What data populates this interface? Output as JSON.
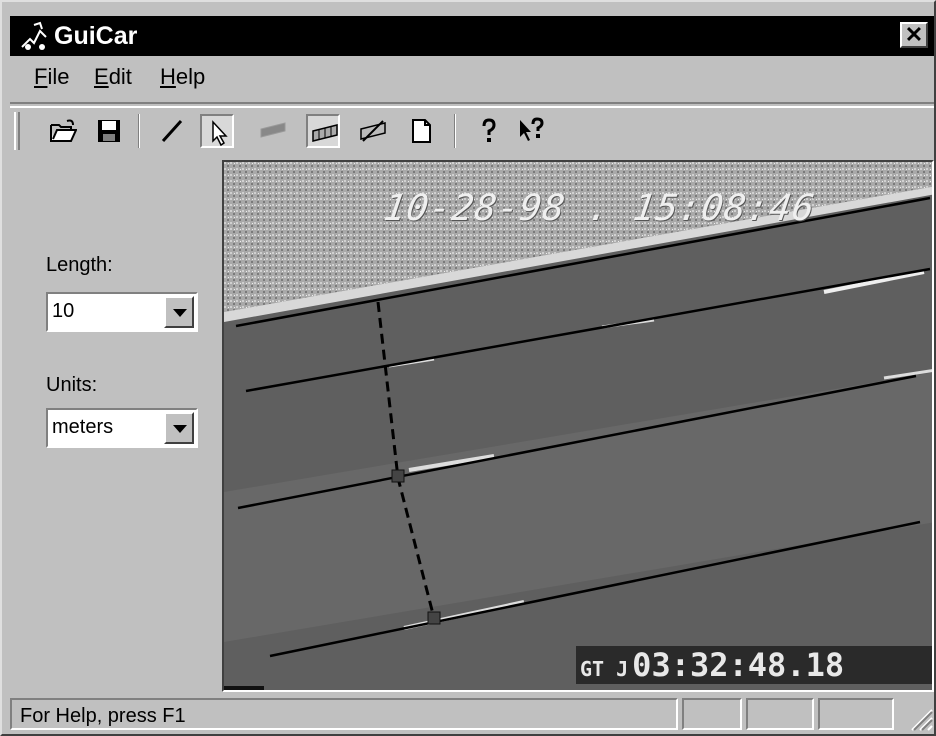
{
  "window": {
    "title": "GuiCar",
    "close_label": "✕"
  },
  "menu": [
    {
      "label": "File",
      "accel": "F",
      "rest": "ile"
    },
    {
      "label": "Edit",
      "accel": "E",
      "rest": "dit"
    },
    {
      "label": "Help",
      "accel": "H",
      "rest": "elp"
    }
  ],
  "toolbar": {
    "buttons": [
      {
        "name": "open-folder",
        "icon": "folder-open-icon"
      },
      {
        "name": "save",
        "icon": "floppy-disk-icon"
      },
      {
        "name": "draw-line",
        "icon": "line-icon"
      },
      {
        "name": "select",
        "icon": "arrow-pointer-icon",
        "pressed": true
      },
      {
        "name": "filled-region",
        "icon": "filled-parallelogram-icon",
        "disabled": true
      },
      {
        "name": "grid-region",
        "icon": "hatched-parallelogram-icon",
        "pressed": true
      },
      {
        "name": "crossed-region",
        "icon": "crossed-parallelogram-icon"
      },
      {
        "name": "new-document",
        "icon": "blank-page-icon"
      },
      {
        "name": "help",
        "icon": "question-mark-icon"
      },
      {
        "name": "context-help",
        "icon": "arrow-question-icon"
      }
    ]
  },
  "sidebar": {
    "length_label": "Length:",
    "length_value": "10",
    "units_label": "Units:",
    "units_value": "meters"
  },
  "video": {
    "date_stamp": "10-28-98  .  15:08:46",
    "time_prefix": "GT J",
    "time_code": "03:32:48.18"
  },
  "status": {
    "text": "For Help, press F1"
  }
}
